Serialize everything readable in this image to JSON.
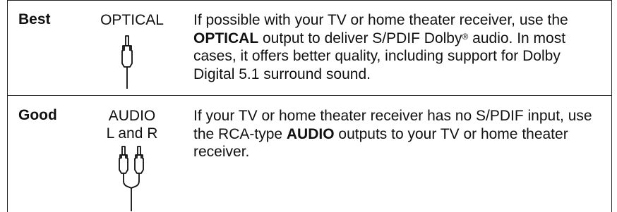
{
  "rows": [
    {
      "rating": "Best",
      "connector": [
        "OPTICAL"
      ],
      "connector_icon": "optical-plug-icon",
      "description": {
        "before": "If possible with your TV or home theater receiver, use the ",
        "strong": "OPTICAL",
        "middle": " output to deliver S/PDIF Dolby",
        "sup": "®",
        "after": " audio. In most cases, it offers better quality, including support for Dolby Digital 5.1 surround sound."
      }
    },
    {
      "rating": "Good",
      "connector": [
        "AUDIO",
        "L and R"
      ],
      "connector_icon": "rca-stereo-plug-icon",
      "description": {
        "before": "If your TV or home theater receiver has no S/PDIF input, use the RCA-type ",
        "strong": "AUDIO",
        "after": " outputs to your TV or home theater receiver."
      }
    }
  ]
}
